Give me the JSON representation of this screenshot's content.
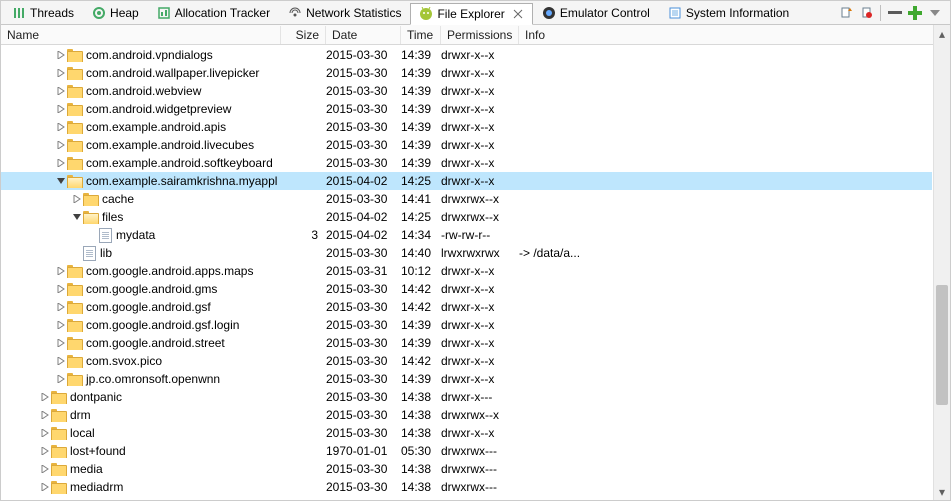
{
  "tabs": [
    {
      "label": "Threads"
    },
    {
      "label": "Heap"
    },
    {
      "label": "Allocation Tracker"
    },
    {
      "label": "Network Statistics"
    },
    {
      "label": "File Explorer",
      "active": true
    },
    {
      "label": "Emulator Control"
    },
    {
      "label": "System Information"
    }
  ],
  "columns": {
    "name": "Name",
    "size": "Size",
    "date": "Date",
    "time": "Time",
    "perm": "Permissions",
    "info": "Info"
  },
  "rows": [
    {
      "indent": 3,
      "arrow": "closed",
      "icon": "folder",
      "name": "com.android.vpndialogs",
      "size": "",
      "date": "2015-03-30",
      "time": "14:39",
      "perm": "drwxr-x--x",
      "info": ""
    },
    {
      "indent": 3,
      "arrow": "closed",
      "icon": "folder",
      "name": "com.android.wallpaper.livepicker",
      "size": "",
      "date": "2015-03-30",
      "time": "14:39",
      "perm": "drwxr-x--x",
      "info": ""
    },
    {
      "indent": 3,
      "arrow": "closed",
      "icon": "folder",
      "name": "com.android.webview",
      "size": "",
      "date": "2015-03-30",
      "time": "14:39",
      "perm": "drwxr-x--x",
      "info": ""
    },
    {
      "indent": 3,
      "arrow": "closed",
      "icon": "folder",
      "name": "com.android.widgetpreview",
      "size": "",
      "date": "2015-03-30",
      "time": "14:39",
      "perm": "drwxr-x--x",
      "info": ""
    },
    {
      "indent": 3,
      "arrow": "closed",
      "icon": "folder",
      "name": "com.example.android.apis",
      "size": "",
      "date": "2015-03-30",
      "time": "14:39",
      "perm": "drwxr-x--x",
      "info": ""
    },
    {
      "indent": 3,
      "arrow": "closed",
      "icon": "folder",
      "name": "com.example.android.livecubes",
      "size": "",
      "date": "2015-03-30",
      "time": "14:39",
      "perm": "drwxr-x--x",
      "info": ""
    },
    {
      "indent": 3,
      "arrow": "closed",
      "icon": "folder",
      "name": "com.example.android.softkeyboard",
      "size": "",
      "date": "2015-03-30",
      "time": "14:39",
      "perm": "drwxr-x--x",
      "info": ""
    },
    {
      "indent": 3,
      "arrow": "open",
      "icon": "folder-open",
      "name": "com.example.sairamkrishna.myappl",
      "size": "",
      "date": "2015-04-02",
      "time": "14:25",
      "perm": "drwxr-x--x",
      "info": "",
      "selected": true
    },
    {
      "indent": 4,
      "arrow": "closed",
      "icon": "folder",
      "name": "cache",
      "size": "",
      "date": "2015-03-30",
      "time": "14:41",
      "perm": "drwxrwx--x",
      "info": ""
    },
    {
      "indent": 4,
      "arrow": "open",
      "icon": "folder-open",
      "name": "files",
      "size": "",
      "date": "2015-04-02",
      "time": "14:25",
      "perm": "drwxrwx--x",
      "info": ""
    },
    {
      "indent": 5,
      "arrow": "none",
      "icon": "file",
      "name": "mydata",
      "size": "3",
      "date": "2015-04-02",
      "time": "14:34",
      "perm": "-rw-rw-r--",
      "info": ""
    },
    {
      "indent": 4,
      "arrow": "none",
      "icon": "file",
      "name": "lib",
      "size": "",
      "date": "2015-03-30",
      "time": "14:40",
      "perm": "lrwxrwxrwx",
      "info": "-> /data/a..."
    },
    {
      "indent": 3,
      "arrow": "closed",
      "icon": "folder",
      "name": "com.google.android.apps.maps",
      "size": "",
      "date": "2015-03-31",
      "time": "10:12",
      "perm": "drwxr-x--x",
      "info": ""
    },
    {
      "indent": 3,
      "arrow": "closed",
      "icon": "folder",
      "name": "com.google.android.gms",
      "size": "",
      "date": "2015-03-30",
      "time": "14:42",
      "perm": "drwxr-x--x",
      "info": ""
    },
    {
      "indent": 3,
      "arrow": "closed",
      "icon": "folder",
      "name": "com.google.android.gsf",
      "size": "",
      "date": "2015-03-30",
      "time": "14:42",
      "perm": "drwxr-x--x",
      "info": ""
    },
    {
      "indent": 3,
      "arrow": "closed",
      "icon": "folder",
      "name": "com.google.android.gsf.login",
      "size": "",
      "date": "2015-03-30",
      "time": "14:39",
      "perm": "drwxr-x--x",
      "info": ""
    },
    {
      "indent": 3,
      "arrow": "closed",
      "icon": "folder",
      "name": "com.google.android.street",
      "size": "",
      "date": "2015-03-30",
      "time": "14:39",
      "perm": "drwxr-x--x",
      "info": ""
    },
    {
      "indent": 3,
      "arrow": "closed",
      "icon": "folder",
      "name": "com.svox.pico",
      "size": "",
      "date": "2015-03-30",
      "time": "14:42",
      "perm": "drwxr-x--x",
      "info": ""
    },
    {
      "indent": 3,
      "arrow": "closed",
      "icon": "folder",
      "name": "jp.co.omronsoft.openwnn",
      "size": "",
      "date": "2015-03-30",
      "time": "14:39",
      "perm": "drwxr-x--x",
      "info": ""
    },
    {
      "indent": 2,
      "arrow": "closed",
      "icon": "folder",
      "name": "dontpanic",
      "size": "",
      "date": "2015-03-30",
      "time": "14:38",
      "perm": "drwxr-x---",
      "info": ""
    },
    {
      "indent": 2,
      "arrow": "closed",
      "icon": "folder",
      "name": "drm",
      "size": "",
      "date": "2015-03-30",
      "time": "14:38",
      "perm": "drwxrwx--x",
      "info": ""
    },
    {
      "indent": 2,
      "arrow": "closed",
      "icon": "folder",
      "name": "local",
      "size": "",
      "date": "2015-03-30",
      "time": "14:38",
      "perm": "drwxr-x--x",
      "info": ""
    },
    {
      "indent": 2,
      "arrow": "closed",
      "icon": "folder",
      "name": "lost+found",
      "size": "",
      "date": "1970-01-01",
      "time": "05:30",
      "perm": "drwxrwx---",
      "info": ""
    },
    {
      "indent": 2,
      "arrow": "closed",
      "icon": "folder",
      "name": "media",
      "size": "",
      "date": "2015-03-30",
      "time": "14:38",
      "perm": "drwxrwx---",
      "info": ""
    },
    {
      "indent": 2,
      "arrow": "closed",
      "icon": "folder",
      "name": "mediadrm",
      "size": "",
      "date": "2015-03-30",
      "time": "14:38",
      "perm": "drwxrwx---",
      "info": ""
    }
  ]
}
